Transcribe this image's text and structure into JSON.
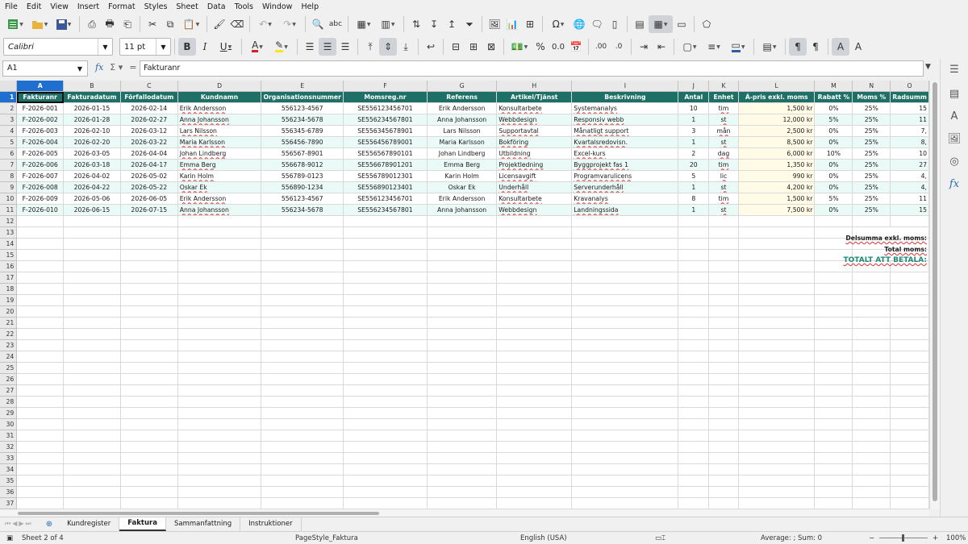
{
  "menu": [
    "File",
    "Edit",
    "View",
    "Insert",
    "Format",
    "Styles",
    "Sheet",
    "Data",
    "Tools",
    "Window",
    "Help"
  ],
  "font": {
    "name": "Calibri",
    "size": "11 pt"
  },
  "formula_bar": {
    "cell_ref": "A1",
    "content": "Fakturanr"
  },
  "columns": [
    "A",
    "B",
    "C",
    "D",
    "E",
    "F",
    "G",
    "H",
    "I",
    "J",
    "K",
    "L",
    "M",
    "N",
    "O"
  ],
  "headers": [
    "Fakturanr",
    "Fakturadatum",
    "Förfallodatum",
    "Kundnamn",
    "Organisationsnummer",
    "Momsreg.nr",
    "Referens",
    "Artikel/Tjänst",
    "Beskrivning",
    "Antal",
    "Enhet",
    "Á-pris exkl. moms",
    "Rabatt %",
    "Moms %",
    "Radsumm"
  ],
  "rows": [
    [
      "F-2026-001",
      "2026-01-15",
      "2026-02-14",
      "Erik Andersson",
      "556123-4567",
      "SE556123456701",
      "Erik Andersson",
      "Konsultarbete",
      "Systemanalys",
      "10",
      "tim",
      "1,500 kr",
      "0%",
      "25%",
      "15"
    ],
    [
      "F-2026-002",
      "2026-01-28",
      "2026-02-27",
      "Anna Johansson",
      "556234-5678",
      "SE556234567801",
      "Anna Johansson",
      "Webbdesign",
      "Responsiv webb",
      "1",
      "st",
      "12,000 kr",
      "5%",
      "25%",
      "11"
    ],
    [
      "F-2026-003",
      "2026-02-10",
      "2026-03-12",
      "Lars Nilsson",
      "556345-6789",
      "SE556345678901",
      "Lars Nilsson",
      "Supportavtal",
      "Månatligt support",
      "3",
      "mån",
      "2,500 kr",
      "0%",
      "25%",
      "7,"
    ],
    [
      "F-2026-004",
      "2026-02-20",
      "2026-03-22",
      "Maria Karlsson",
      "556456-7890",
      "SE556456789001",
      "Maria Karlsson",
      "Bokföring",
      "Kvartalsredovisn.",
      "1",
      "st",
      "8,500 kr",
      "0%",
      "25%",
      "8,"
    ],
    [
      "F-2026-005",
      "2026-03-05",
      "2026-04-04",
      "Johan Lindberg",
      "556567-8901",
      "SE556567890101",
      "Johan Lindberg",
      "Utbildning",
      "Excel-kurs",
      "2",
      "dag",
      "6,000 kr",
      "10%",
      "25%",
      "10"
    ],
    [
      "F-2026-006",
      "2026-03-18",
      "2026-04-17",
      "Emma Berg",
      "556678-9012",
      "SE556678901201",
      "Emma Berg",
      "Projektledning",
      "Byggprojekt fas 1",
      "20",
      "tim",
      "1,350 kr",
      "0%",
      "25%",
      "27"
    ],
    [
      "F-2026-007",
      "2026-04-02",
      "2026-05-02",
      "Karin Holm",
      "556789-0123",
      "SE556789012301",
      "Karin Holm",
      "Licensavgift",
      "Programvarulicens",
      "5",
      "lic",
      "990 kr",
      "0%",
      "25%",
      "4,"
    ],
    [
      "F-2026-008",
      "2026-04-22",
      "2026-05-22",
      "Oskar Ek",
      "556890-1234",
      "SE556890123401",
      "Oskar Ek",
      "Underhåll",
      "Serverunderhåll",
      "1",
      "st",
      "4,200 kr",
      "0%",
      "25%",
      "4,"
    ],
    [
      "F-2026-009",
      "2026-05-06",
      "2026-06-05",
      "Erik Andersson",
      "556123-4567",
      "SE556123456701",
      "Erik Andersson",
      "Konsultarbete",
      "Kravanalys",
      "8",
      "tim",
      "1,500 kr",
      "5%",
      "25%",
      "11"
    ],
    [
      "F-2026-010",
      "2026-06-15",
      "2026-07-15",
      "Anna Johansson",
      "556234-5678",
      "SE556234567801",
      "Anna Johansson",
      "Webbdesign",
      "Landningssida",
      "1",
      "st",
      "7,500 kr",
      "0%",
      "25%",
      "15"
    ]
  ],
  "summary": {
    "subtotal_label": "Delsumma exkl. moms:",
    "vat_label": "Total moms:",
    "total_label": "TOTALT ATT BETALA:"
  },
  "tabs": [
    "Kundregister",
    "Faktura",
    "Sammanfattning",
    "Instruktioner"
  ],
  "active_tab": "Faktura",
  "status": {
    "sheet": "Sheet 2 of 4",
    "page_style": "PageStyle_Faktura",
    "language": "English (USA)",
    "sum": "Average: ; Sum: 0",
    "zoom": "100%"
  },
  "colors": {
    "header_bg": "#1e6f66",
    "even_row_bg": "#eafaf6",
    "price_bg": "#fffbe6",
    "selection": "#1f6fd0",
    "total_label": "#1e8a7a"
  }
}
